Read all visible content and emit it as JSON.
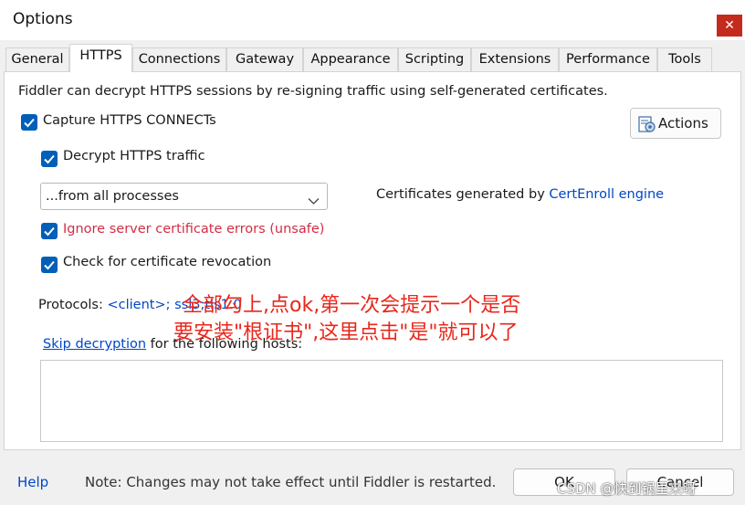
{
  "window": {
    "title": "Options",
    "close_glyph": "✕"
  },
  "tabs": [
    {
      "label": "General"
    },
    {
      "label": "HTTPS"
    },
    {
      "label": "Connections"
    },
    {
      "label": "Gateway"
    },
    {
      "label": "Appearance"
    },
    {
      "label": "Scripting"
    },
    {
      "label": "Extensions"
    },
    {
      "label": "Performance"
    },
    {
      "label": "Tools"
    }
  ],
  "active_tab": "HTTPS",
  "https": {
    "intro": "Fiddler can decrypt HTTPS sessions by re-signing traffic using self-generated certificates.",
    "capture_label": "Capture HTTPS CONNECTs",
    "capture_checked": true,
    "actions_label": "Actions",
    "decrypt_label": "Decrypt HTTPS traffic",
    "decrypt_checked": true,
    "process_filter": "...from all processes",
    "certs_prefix": "Certificates generated by",
    "certs_engine": "CertEnroll engine",
    "ignore_errors_label": "Ignore server certificate errors (unsafe)",
    "ignore_errors_checked": true,
    "revocation_label": "Check for certificate revocation",
    "revocation_checked": true,
    "protocols_label": "Protocols:",
    "protocols_value": "<client>; ssl3;tls1.0",
    "skip_link": "Skip decryption",
    "skip_suffix": "for the following hosts:"
  },
  "annotation": {
    "line1": "全部勾上,点ok,第一次会提示一个是否",
    "line2": "要安装\"根证书\",这里点击\"是\"就可以了"
  },
  "footer": {
    "help": "Help",
    "note": "Note: Changes may not take effect until Fiddler is restarted.",
    "ok": "OK",
    "cancel": "Cancel"
  },
  "watermark": "CSDN @快到锅里来呀",
  "colors": {
    "accent": "#005fb8",
    "link": "#0046c8",
    "danger": "#d22d45",
    "annotation": "#e8271c",
    "close": "#c42b1c"
  },
  "icons": {
    "close": "close-icon",
    "actions": "settings-gear-icon",
    "dropdown": "chevron-down-icon",
    "check": "checkmark-icon"
  }
}
